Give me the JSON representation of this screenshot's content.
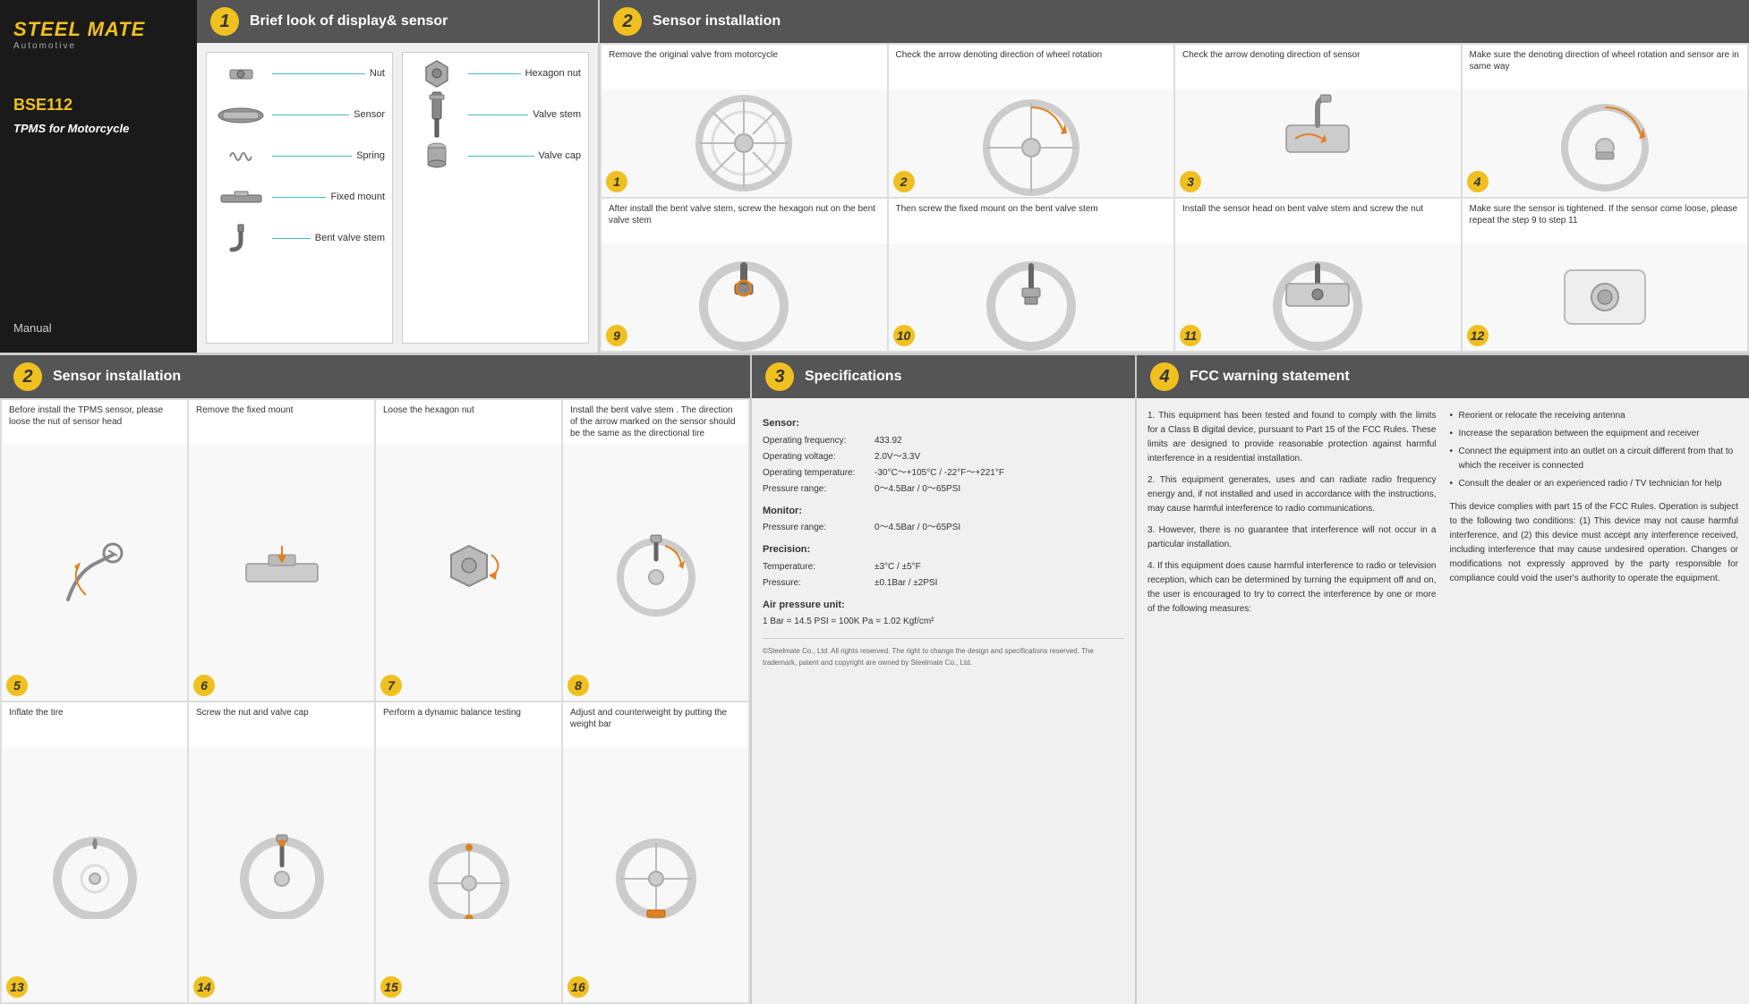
{
  "brand": {
    "name": "STEEL MATE",
    "sub": "Automotive",
    "model": "BSE112",
    "description": "TPMS for Motorcycle",
    "manual": "Manual"
  },
  "section1": {
    "number": "1",
    "title": "Brief look of display& sensor",
    "parts_left": [
      {
        "name": "Nut",
        "shape": "nut"
      },
      {
        "name": "Sensor",
        "shape": "sensor"
      },
      {
        "name": "Spring",
        "shape": "spring"
      },
      {
        "name": "Fixed mount",
        "shape": "mount"
      },
      {
        "name": "Bent valve stem",
        "shape": "valve"
      }
    ],
    "parts_right": [
      {
        "name": "Hexagon nut",
        "shape": "hexnut"
      },
      {
        "name": "Valve stem",
        "shape": "valvestem"
      },
      {
        "name": "Valve cap",
        "shape": "valvecap"
      }
    ]
  },
  "section2_top": {
    "number": "2",
    "title": "Sensor installation",
    "steps": [
      {
        "num": "1",
        "desc": "Remove the original valve from motorcycle"
      },
      {
        "num": "2",
        "desc": "Check the arrow denoting direction of wheel rotation"
      },
      {
        "num": "3",
        "desc": "Check the arrow denoting direction of sensor"
      },
      {
        "num": "4",
        "desc": "Make sure the denoting direction of wheel rotation and sensor are in same way"
      },
      {
        "num": "9",
        "desc": "After install the bent valve stem, screw the hexagon nut on the bent valve stem"
      },
      {
        "num": "10",
        "desc": "Then screw the fixed mount on the bent valve stem"
      },
      {
        "num": "11",
        "desc": "Install the sensor head on bent valve stem and screw the nut"
      },
      {
        "num": "12",
        "desc": "Make sure the sensor is tightened. If the sensor come loose, please repeat the step 9 to step 11"
      }
    ]
  },
  "section2_bottom": {
    "number": "2",
    "title": "Sensor installation",
    "steps": [
      {
        "num": "5",
        "desc": "Before install the TPMS sensor, please loose the nut of sensor head"
      },
      {
        "num": "6",
        "desc": "Remove the fixed mount"
      },
      {
        "num": "7",
        "desc": "Loose the hexagon nut"
      },
      {
        "num": "8",
        "desc": "Install the bent valve stem . The direction of the arrow marked on the sensor should be the same as the directional tire"
      },
      {
        "num": "13",
        "desc": "Inflate the tire"
      },
      {
        "num": "14",
        "desc": "Screw the nut and valve cap"
      },
      {
        "num": "15",
        "desc": "Perform a dynamic balance testing"
      },
      {
        "num": "16",
        "desc": "Adjust and counterweight by putting the weight bar"
      }
    ]
  },
  "section3": {
    "number": "3",
    "title": "Specifications",
    "sensor": {
      "title": "Sensor:",
      "rows": [
        {
          "label": "Operating frequency:",
          "value": "433.92"
        },
        {
          "label": "Operating voltage:",
          "value": "2.0V～3.3V"
        },
        {
          "label": "Operating temperature:",
          "value": "-30°C～+105°C / -22°F～+221°F"
        },
        {
          "label": "Pressure range:",
          "value": "0～4.5Bar / 0～65PSI"
        }
      ]
    },
    "monitor": {
      "title": "Monitor:",
      "rows": [
        {
          "label": "Pressure range:",
          "value": "0～4.5Bar / 0～65PSI"
        }
      ]
    },
    "precision": {
      "title": "Precision:",
      "rows": [
        {
          "label": "Temperature:",
          "value": "±3°C / ±5°F"
        },
        {
          "label": "Pressure:",
          "value": "±0.1Bar / ±2PSI"
        }
      ]
    },
    "air_pressure": {
      "title": "Air pressure unit:",
      "value": "1 Bar = 14.5 PSI = 100K Pa = 1.02 Kgf/cm²"
    },
    "footer": "©Steelmate Co., Ltd. All rights reserved.\nThe right to change the design and specifications reserved.\nThe trademark, patent and copyright are owned by Steelmate Co., Ltd."
  },
  "section4": {
    "number": "4",
    "title": "FCC warning statement",
    "paragraphs": [
      "1. This equipment has been tested and found to comply with the limits for a Class B digital device, pursuant to Part 15 of the FCC Rules. These limits are designed to provide reasonable protection against harmful interference in a residential installation.",
      "2. This equipment generates, uses and can radiate radio frequency energy and, if not installed and used in accordance with the instructions, may cause harmful interference to radio communications.",
      "3. However, there is no guarantee that interference will not occur in a particular installation.",
      "4. If this equipment does cause harmful interference to radio or television reception, which can be determined by turning the equipment off and on, the user is encouraged to try to correct the interference by one or more of the following measures:"
    ],
    "bullets": [
      "Reorient or relocate the receiving antenna",
      "Increase the separation between the equipment and receiver",
      "Connect the equipment into an outlet on a circuit different from that to which the receiver is connected",
      "Consult the dealer or an experienced radio / TV technician for help"
    ],
    "compliance": "This device complies with part 15 of the FCC Rules. Operation is subject to the following two conditions: (1) This device may not cause harmful interference, and (2) this device must accept any interference received, including interference that may cause undesired operation.\nChanges or modifications not expressly approved by the party responsible for compliance could void the user's authority to operate the equipment."
  }
}
